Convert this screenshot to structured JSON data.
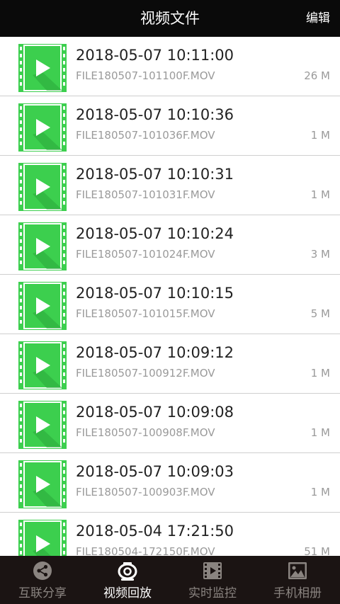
{
  "header": {
    "title": "视频文件",
    "edit_label": "编辑"
  },
  "colors": {
    "thumbnail_green": "#3ccf4e",
    "header_bg": "#0a0a0a",
    "tabbar_bg": "#1b1413"
  },
  "files": [
    {
      "datetime": "2018-05-07 10:11:00",
      "filename": "FILE180507-101100F.MOV",
      "size": "26 M"
    },
    {
      "datetime": "2018-05-07 10:10:36",
      "filename": "FILE180507-101036F.MOV",
      "size": "1 M"
    },
    {
      "datetime": "2018-05-07 10:10:31",
      "filename": "FILE180507-101031F.MOV",
      "size": "1 M"
    },
    {
      "datetime": "2018-05-07 10:10:24",
      "filename": "FILE180507-101024F.MOV",
      "size": "3 M"
    },
    {
      "datetime": "2018-05-07 10:10:15",
      "filename": "FILE180507-101015F.MOV",
      "size": "5 M"
    },
    {
      "datetime": "2018-05-07 10:09:12",
      "filename": "FILE180507-100912F.MOV",
      "size": "1 M"
    },
    {
      "datetime": "2018-05-07 10:09:08",
      "filename": "FILE180507-100908F.MOV",
      "size": "1 M"
    },
    {
      "datetime": "2018-05-07 10:09:03",
      "filename": "FILE180507-100903F.MOV",
      "size": "1 M"
    },
    {
      "datetime": "2018-05-04 17:21:50",
      "filename": "FILE180504-172150F.MOV",
      "size": "51 M"
    }
  ],
  "tabs": [
    {
      "label": "互联分享",
      "icon": "share-icon",
      "active": false
    },
    {
      "label": "视频回放",
      "icon": "camera-lens-icon",
      "active": true
    },
    {
      "label": "实时监控",
      "icon": "film-icon",
      "active": false
    },
    {
      "label": "手机相册",
      "icon": "photo-icon",
      "active": false
    }
  ]
}
